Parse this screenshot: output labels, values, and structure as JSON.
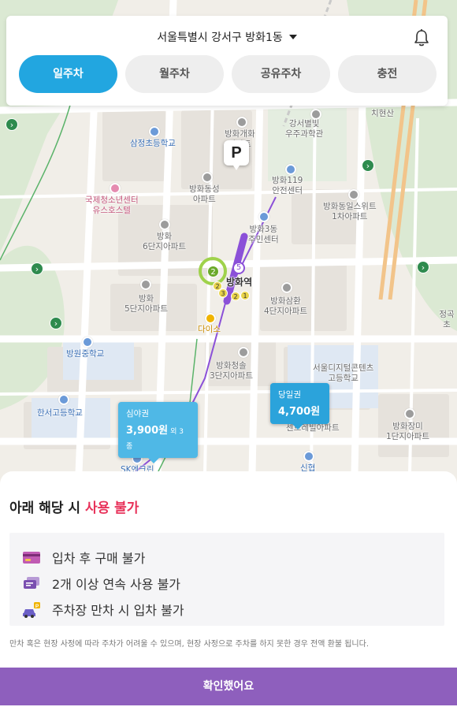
{
  "header": {
    "location": "서울특별시 강서구 방화1동",
    "bell_icon": "bell-icon"
  },
  "tabs": [
    {
      "label": "일주차",
      "active": true
    },
    {
      "label": "월주차",
      "active": false
    },
    {
      "label": "공유주차",
      "active": false
    },
    {
      "label": "충전",
      "active": false
    }
  ],
  "map": {
    "labels": [
      "삼정초등학교",
      "방화개화\n아파트",
      "강서별빛\n우주과학관",
      "치현산",
      "국제청소년센터\n유스호스텔",
      "방화동성\n아파트",
      "방화119\n안전센터",
      "방화3동\n주민센터",
      "방화동일스위트\n1차아파트",
      "방화\n6단지아파트",
      "방화역",
      "방화\n5단지아파트",
      "방화삼환\n4단지아파트",
      "다이소",
      "정곡초",
      "방원중학교",
      "방화청솔\n3단지아파트",
      "서울디지털콘텐츠\n고등학교",
      "한서고등학교",
      "센트레빌아파트",
      "방화장미\n1단지아파트",
      "SK엔크린",
      "신협"
    ],
    "station_badges": [
      "2",
      "5",
      "2",
      "3",
      "2",
      "1"
    ],
    "parking_marker_label": "P",
    "price_markers": [
      {
        "type": "심야권",
        "price": "3,900원",
        "extra": "외 3종"
      },
      {
        "type": "당일권",
        "price": "4,700원",
        "extra": ""
      }
    ]
  },
  "sheet": {
    "title_prefix": "아래 해당 시",
    "title_highlight": "사용 불가",
    "rules": [
      {
        "icon": "credit-card-icon",
        "text": "입차 후 구매 불가"
      },
      {
        "icon": "tickets-icon",
        "text": "2개 이상 연속 사용 불가"
      },
      {
        "icon": "full-parking-car-icon",
        "text": "주차장 만차 시 입차 불가"
      }
    ],
    "note": "만차 혹은 현장 사정에 따라 주차가 어려울 수 있으며, 현장 사정으로 주차를 하지 못한 경우 전액 환불 됩니다.",
    "confirm_label": "확인했어요"
  },
  "colors": {
    "accent": "#22a6e0",
    "highlight": "#e8325a",
    "confirm": "#8e5fbd",
    "subway_line5": "#8b50d8"
  }
}
